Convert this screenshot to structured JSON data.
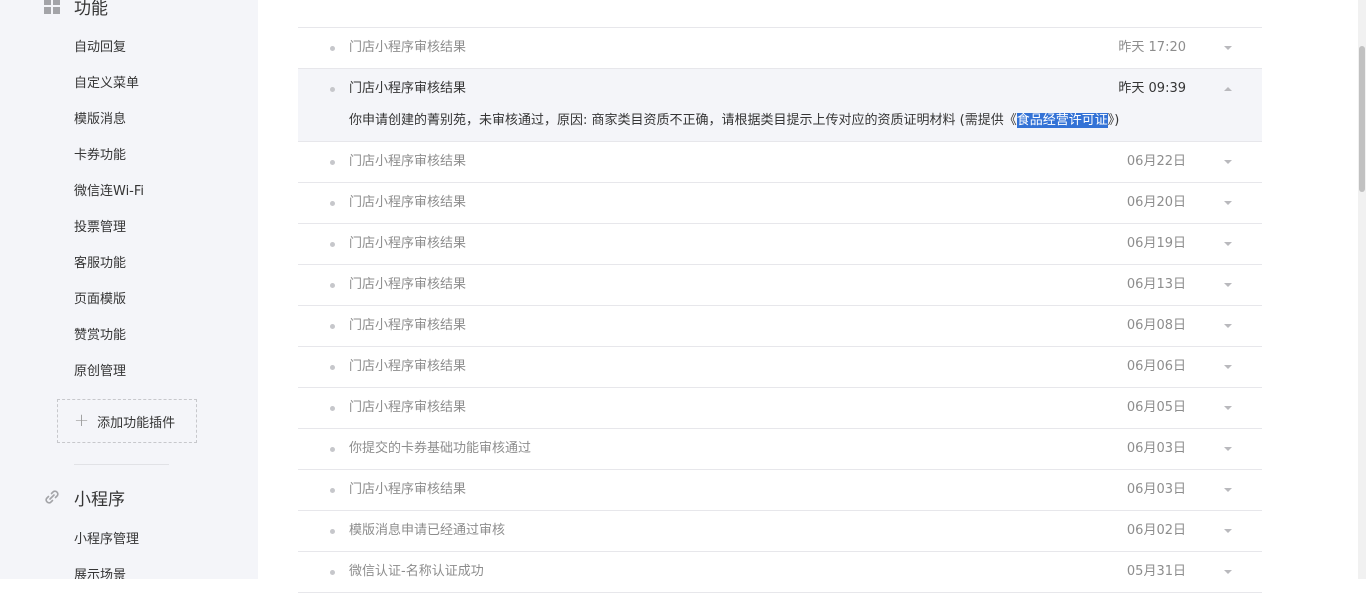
{
  "sidebar": {
    "function_section": {
      "title": "功能",
      "icon": "grid-icon",
      "items": [
        {
          "label": "自动回复"
        },
        {
          "label": "自定义菜单"
        },
        {
          "label": "模版消息"
        },
        {
          "label": "卡券功能"
        },
        {
          "label": "微信连Wi-Fi"
        },
        {
          "label": "投票管理"
        },
        {
          "label": "客服功能"
        },
        {
          "label": "页面模版"
        },
        {
          "label": "赞赏功能"
        },
        {
          "label": "原创管理"
        }
      ],
      "add_plugin_label": "添加功能插件"
    },
    "miniprogram_section": {
      "title": "小程序",
      "icon": "link-icon",
      "items": [
        {
          "label": "小程序管理"
        },
        {
          "label": "展示场景"
        }
      ]
    }
  },
  "messages": [
    {
      "title": "门店小程序审核结果",
      "date": "昨天 17:20"
    },
    {
      "title": "门店小程序审核结果",
      "date": "昨天 09:39",
      "expanded": true,
      "detail_prefix": "你申请创建的菁别苑，未审核通过，原因: 商家类目资质不正确，请根据类目提示上传对应的资质证明材料 (需提供《",
      "detail_highlight": "食品经营许可证",
      "detail_suffix": "》)"
    },
    {
      "title": "门店小程序审核结果",
      "date": "06月22日"
    },
    {
      "title": "门店小程序审核结果",
      "date": "06月20日"
    },
    {
      "title": "门店小程序审核结果",
      "date": "06月19日"
    },
    {
      "title": "门店小程序审核结果",
      "date": "06月13日"
    },
    {
      "title": "门店小程序审核结果",
      "date": "06月08日"
    },
    {
      "title": "门店小程序审核结果",
      "date": "06月06日"
    },
    {
      "title": "门店小程序审核结果",
      "date": "06月05日"
    },
    {
      "title": "你提交的卡券基础功能审核通过",
      "date": "06月03日"
    },
    {
      "title": "门店小程序审核结果",
      "date": "06月03日"
    },
    {
      "title": "模版消息申请已经通过审核",
      "date": "06月02日"
    },
    {
      "title": "微信认证-名称认证成功",
      "date": "05月31日"
    }
  ],
  "colors": {
    "sidebar_bg": "#f4f5f9",
    "highlight": "#3372d6"
  }
}
